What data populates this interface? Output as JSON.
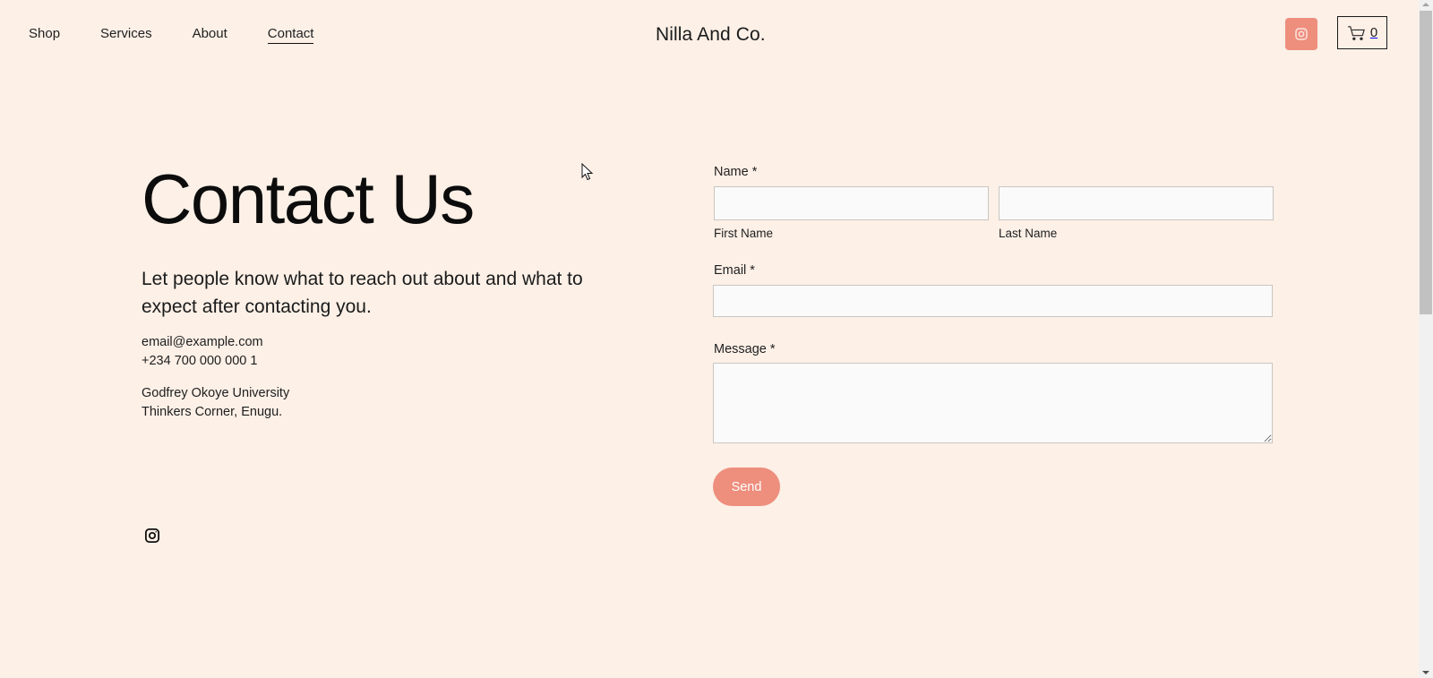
{
  "header": {
    "nav": [
      {
        "label": "Shop",
        "active": false
      },
      {
        "label": "Services",
        "active": false
      },
      {
        "label": "About",
        "active": false
      },
      {
        "label": "Contact",
        "active": true
      }
    ],
    "brand": "Nilla And Co.",
    "instagram_icon": "instagram-icon",
    "cart": {
      "icon": "cart-icon",
      "count": "0"
    }
  },
  "main": {
    "title": "Contact Us",
    "subtitle": "Let people know what to reach out about and what to expect after contacting you.",
    "email": "email@example.com",
    "phone": "+234 700 000 000 1",
    "address_line1": "Godfrey Okoye University",
    "address_line2": "Thinkers Corner, Enugu.",
    "social_icon": "instagram-icon"
  },
  "form": {
    "name_label": "Name *",
    "first_name_label": "First Name",
    "first_name_value": "",
    "last_name_label": "Last Name",
    "last_name_value": "",
    "email_label": "Email *",
    "email_value": "",
    "message_label": "Message *",
    "message_value": "",
    "send_label": "Send"
  },
  "colors": {
    "background": "#fcf0e7",
    "accent": "#ee8e7d",
    "text": "#1a1a1a",
    "field_bg": "#fafafa"
  }
}
